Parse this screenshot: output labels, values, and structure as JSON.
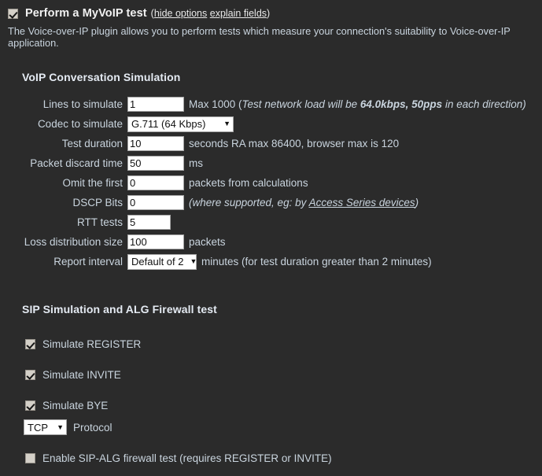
{
  "theme": {
    "background": "#2b2b2b",
    "text": "#c9d4de",
    "heading": "#e4eaf2",
    "title": "#f2f2f2",
    "field_bg": "#ffffff",
    "field_text": "#111111",
    "checkbox_bg": "#d4d0c8"
  },
  "header": {
    "checkbox_checked": true,
    "title": "Perform a MyVoIP test",
    "links_open": "(",
    "link_hide_options": "hide options",
    "link_space": " ",
    "link_explain_fields": "explain fields",
    "links_close": ")",
    "description": "The Voice-over-IP plugin allows you to perform tests which measure your connection's suitability to Voice-over-IP application."
  },
  "voip_section": {
    "heading": "VoIP Conversation Simulation",
    "rows": [
      {
        "label": "Lines to simulate",
        "control": "text",
        "value": "1",
        "width": "normal",
        "suffix_plain_1": "Max 1000 (",
        "suffix_italic_1": "Test network load will be ",
        "suffix_bolditalic": "64.0kbps, 50pps",
        "suffix_italic_2": " in each direction)"
      },
      {
        "label": "Codec to simulate",
        "control": "select",
        "value": "G.711 (64 Kbps)",
        "arrow": "▼",
        "suffix": ""
      },
      {
        "label": "Test duration",
        "control": "text",
        "value": "10",
        "width": "normal",
        "suffix": "seconds RA max 86400, browser max is 120"
      },
      {
        "label": "Packet discard time",
        "control": "text",
        "value": "50",
        "width": "normal",
        "suffix": "ms"
      },
      {
        "label": "Omit the first",
        "control": "text",
        "value": "0",
        "width": "normal",
        "suffix": "packets from calculations"
      },
      {
        "label": "DSCP Bits",
        "control": "text",
        "value": "0",
        "width": "normal",
        "suffix_italic_1": "(where supported, eg: by ",
        "suffix_link": "Access Series devices",
        "suffix_italic_2": ")"
      },
      {
        "label": "RTT tests",
        "control": "text",
        "value": "5",
        "width": "short",
        "suffix": ""
      },
      {
        "label": "Loss distribution size",
        "control": "text",
        "value": "100",
        "width": "normal",
        "suffix": "packets"
      },
      {
        "label": "Report interval",
        "control": "select",
        "value": "Default of 2",
        "arrow": "▼",
        "suffix": "minutes (for test duration greater than 2 minutes)"
      }
    ]
  },
  "sip_section": {
    "heading": "SIP Simulation and ALG Firewall test",
    "checkboxes": [
      {
        "label": "Simulate REGISTER",
        "checked": true
      },
      {
        "label": "Simulate INVITE",
        "checked": true
      },
      {
        "label": "Simulate BYE",
        "checked": true
      }
    ],
    "protocol": {
      "value": "TCP",
      "arrow": "▼",
      "label": "Protocol"
    },
    "alg": {
      "label": "Enable SIP-ALG firewall test (requires REGISTER or INVITE)",
      "checked": false
    }
  }
}
